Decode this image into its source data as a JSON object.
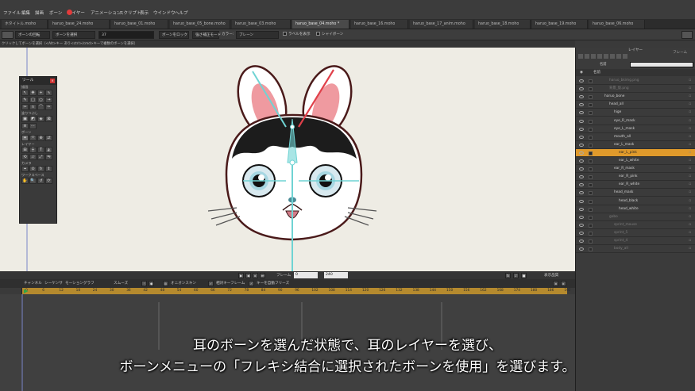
{
  "menu": [
    "ファイル",
    "編集",
    "描画",
    "ボーン",
    "レイヤー",
    "アニメーション",
    "スクリプト",
    "表示",
    "ウインドウ",
    "ヘルプ"
  ],
  "tabs": [
    {
      "label": "ホタイトル.moho",
      "active": false
    },
    {
      "label": "haruo_base_24.moho",
      "active": false
    },
    {
      "label": "haruo_base_01.moho",
      "active": false
    },
    {
      "label": "haruo_base_05_bone.moho",
      "active": false
    },
    {
      "label": "haruo_base_03.moho",
      "active": false
    },
    {
      "label": "haruo_base_04.moho *",
      "active": true
    },
    {
      "label": "haruo_base_16.moho",
      "active": false
    },
    {
      "label": "haruo_base_17_anim.moho",
      "active": false
    },
    {
      "label": "haruo_base_18.moho",
      "active": false
    },
    {
      "label": "haruo_base_19.moho",
      "active": false
    },
    {
      "label": "haruo_base_06.moho",
      "active": false
    }
  ],
  "options": {
    "bone_transform": "ボーンの回転",
    "bone_select": "ボーンを選択",
    "bone_value": "37",
    "bone_lock": "ボーンをロック",
    "strength_mode": "強さ補正モード",
    "color_label": "カラー:",
    "color_value": "ブレーン",
    "show_label": "ラベルを表示",
    "shy_bones": "シャイボーン"
  },
  "status": "クリックしてボーンを選択（<Alt>キー あり<ctrl>/cmd>キーで複数のボーンを選択）",
  "tool_panel": {
    "title": "ツール",
    "sections": [
      "描画",
      "塗りつぶし",
      "ボーン",
      "レイヤー",
      "カメラ",
      "ワークスペース"
    ]
  },
  "layers_panel": {
    "title": "レイヤー",
    "subtitle": "フレーム",
    "name_label": "名前",
    "column_name": "名前",
    "rows": [
      {
        "name": "haruo_bkimg.png",
        "indent": 3,
        "state": "dim"
      },
      {
        "name": "背景_仮.png",
        "indent": 3,
        "state": "dim"
      },
      {
        "name": "haruo_bone",
        "indent": 2,
        "state": "normal"
      },
      {
        "name": "head_all",
        "indent": 3,
        "state": "normal"
      },
      {
        "name": "hige",
        "indent": 4,
        "state": "normal"
      },
      {
        "name": "eye_R_mask",
        "indent": 4,
        "state": "normal"
      },
      {
        "name": "eye_L_mask",
        "indent": 4,
        "state": "normal"
      },
      {
        "name": "mouth_all",
        "indent": 4,
        "state": "normal"
      },
      {
        "name": "ear_L_mask",
        "indent": 4,
        "state": "normal"
      },
      {
        "name": "ear_L_pink",
        "indent": 5,
        "state": "selected"
      },
      {
        "name": "ear_L_white",
        "indent": 5,
        "state": "normal"
      },
      {
        "name": "ear_R_mask",
        "indent": 4,
        "state": "normal"
      },
      {
        "name": "ear_R_pink",
        "indent": 5,
        "state": "normal"
      },
      {
        "name": "ear_R_white",
        "indent": 5,
        "state": "normal"
      },
      {
        "name": "head_mask",
        "indent": 4,
        "state": "normal"
      },
      {
        "name": "head_black",
        "indent": 5,
        "state": "normal"
      },
      {
        "name": "head_white",
        "indent": 5,
        "state": "normal"
      },
      {
        "name": "gobo",
        "indent": 3,
        "state": "dim"
      },
      {
        "name": "sprint_mouse",
        "indent": 4,
        "state": "dim"
      },
      {
        "name": "sprint_5",
        "indent": 4,
        "state": "dim"
      },
      {
        "name": "sprint_4",
        "indent": 4,
        "state": "dim"
      },
      {
        "name": "body_all",
        "indent": 4,
        "state": "dim"
      }
    ]
  },
  "playback": {
    "frame_label": "フレーム",
    "frame_value": "0",
    "total_value": "240",
    "display_quality": "表示品質"
  },
  "timeline": {
    "tabs": [
      "チャンネル",
      "シーケンサ",
      "モーショングラフ"
    ],
    "smooth": "スムーズ",
    "onion": "オニオンスキン",
    "relative_kf": "相対キーフレーム",
    "auto_freeze": "キーを自動フリーズ",
    "ruler": [
      "0",
      "6",
      "12",
      "18",
      "24",
      "30",
      "36",
      "42",
      "48",
      "54",
      "60",
      "66",
      "72",
      "78",
      "84",
      "90",
      "96",
      "102",
      "108",
      "114",
      "120",
      "126",
      "132",
      "138",
      "144",
      "150",
      "156",
      "162",
      "168",
      "174",
      "180",
      "186",
      "192"
    ]
  },
  "subtitle": {
    "line1": "耳のボーンを選んだ状態で、耳のレイヤーを選び、",
    "line2": "ボーンメニューの「フレキシ結合に選択されたボーンを使用」を選びます。"
  },
  "colors": {
    "canvas": "#eeece4",
    "bone": "#6fd3d3",
    "selected_bone": "#e0404a",
    "ruler": "#b58a2e",
    "selected_layer": "#e09a2b"
  }
}
